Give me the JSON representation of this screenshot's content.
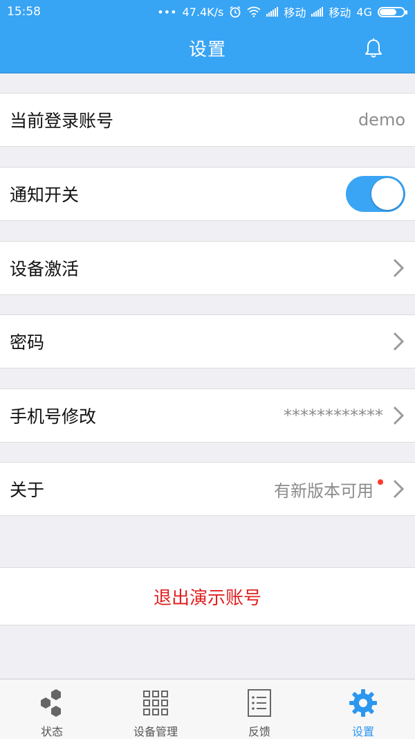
{
  "status_bar": {
    "time": "15:58",
    "dots": "•••",
    "speed": "47.4K/s",
    "carrier1": "移动",
    "carrier2": "移动",
    "network": "4G"
  },
  "header": {
    "title": "设置"
  },
  "settings": {
    "account": {
      "label": "当前登录账号",
      "value": "demo"
    },
    "notify": {
      "label": "通知开关",
      "enabled": true
    },
    "activate": {
      "label": "设备激活"
    },
    "password": {
      "label": "密码"
    },
    "phone": {
      "label": "手机号修改",
      "value": "************"
    },
    "about": {
      "label": "关于",
      "value": "有新版本可用"
    }
  },
  "logout": {
    "label": "退出演示账号"
  },
  "tabs": [
    {
      "label": "状态",
      "icon": "hexagons-icon"
    },
    {
      "label": "设备管理",
      "icon": "grid-icon"
    },
    {
      "label": "反馈",
      "icon": "list-icon"
    },
    {
      "label": "设置",
      "icon": "gear-icon",
      "active": true
    }
  ],
  "colors": {
    "primary": "#38a4f4",
    "danger": "#e02020",
    "badge": "#ff3b30"
  }
}
